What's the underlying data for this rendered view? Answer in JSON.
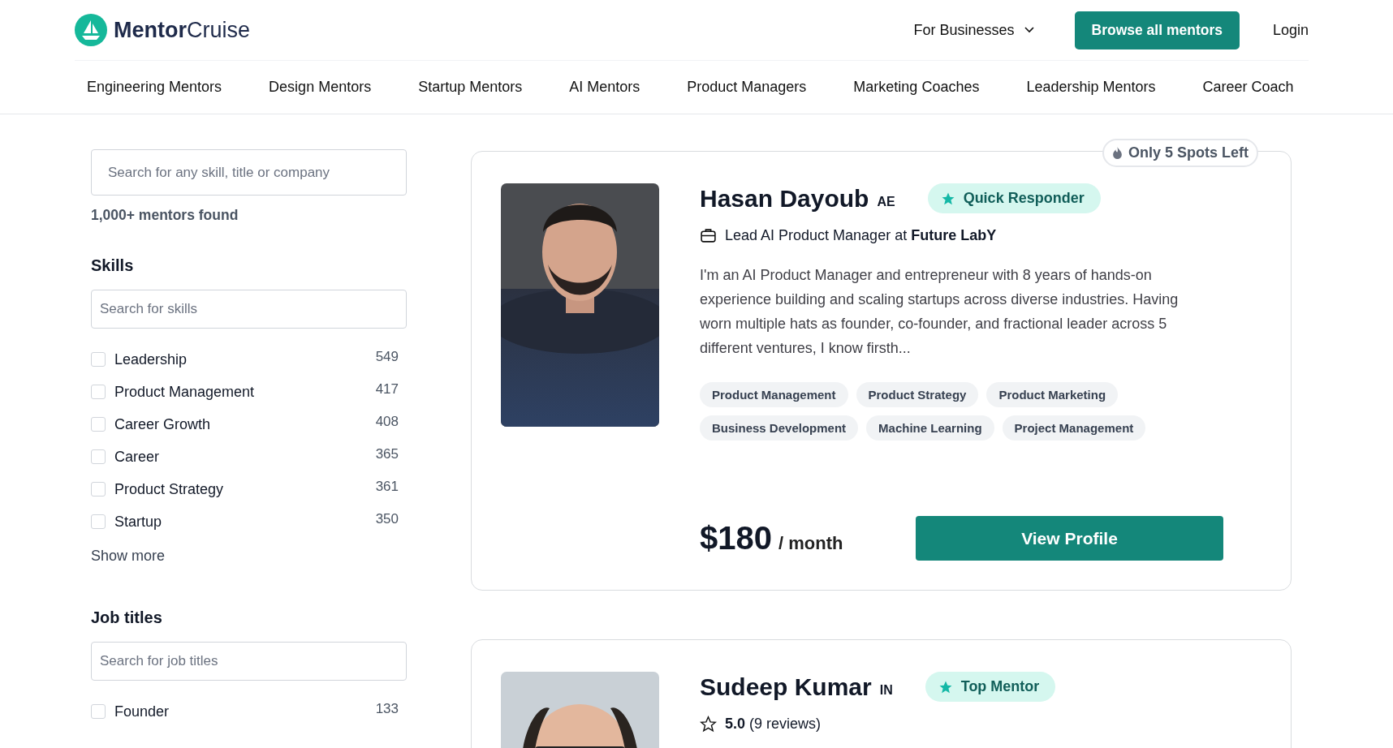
{
  "logo": {
    "brand_bold": "Mentor",
    "brand_light": "Cruise"
  },
  "header": {
    "menu": "For Businesses",
    "cta": "Browse all mentors",
    "login": "Login"
  },
  "categories": [
    "Engineering Mentors",
    "Design Mentors",
    "Startup Mentors",
    "AI Mentors",
    "Product Managers",
    "Marketing Coaches",
    "Leadership Mentors",
    "Career Coach"
  ],
  "sidebar": {
    "search": {
      "placeholder": "Search for any skill, title or company"
    },
    "result_count": "1,000+ mentors found",
    "filters": [
      {
        "title": "Skills",
        "placeholder": "Search for skills",
        "items": [
          {
            "label": "Leadership",
            "count": "549",
            "checked": false
          },
          {
            "label": "Product Management",
            "count": "417",
            "checked": false
          },
          {
            "label": "Career Growth",
            "count": "408",
            "checked": false
          },
          {
            "label": "Career",
            "count": "365",
            "checked": false
          },
          {
            "label": "Product Strategy",
            "count": "361",
            "checked": false
          },
          {
            "label": "Startup",
            "count": "350",
            "checked": false
          }
        ],
        "more": "Show more"
      },
      {
        "title": "Job titles",
        "placeholder": "Search for job titles",
        "items": [
          {
            "label": "Founder",
            "count": "133",
            "checked": false
          }
        ]
      }
    ]
  },
  "mentors": [
    {
      "name": "Hasan Dayoub",
      "country": "AE",
      "badge": "Quick Responder",
      "spots": "Only 5 Spots Left",
      "title": "Lead AI Product Manager at **Future LabY**",
      "bio": "I'm an AI Product Manager and entrepreneur with 8 years of hands-on experience building and scaling startups across diverse industries. Having worn multiple hats as founder, co-founder, and fractional leader across 5 different ventures, I know firsth...",
      "tags": [
        "Product Management",
        "Product Strategy",
        "Product Marketing",
        "Business Development",
        "Machine Learning",
        "Project Management"
      ],
      "price": "$180",
      "period": "/ month",
      "button": "View Profile"
    },
    {
      "name": "Sudeep Kumar",
      "country": "IN",
      "badge": "Top Mentor",
      "rating": "**5.0** (9 reviews)"
    }
  ]
}
